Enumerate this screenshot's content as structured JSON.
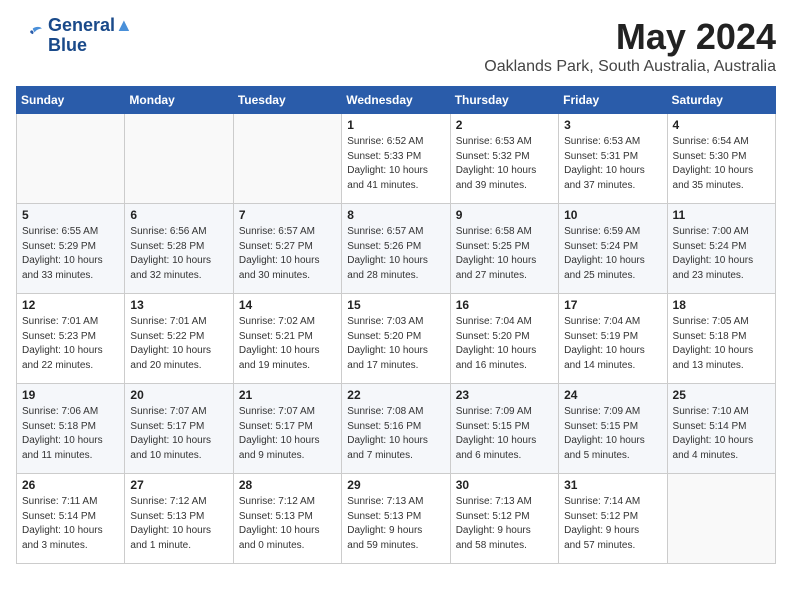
{
  "logo": {
    "line1": "General",
    "line2": "Blue"
  },
  "title": "May 2024",
  "location": "Oaklands Park, South Australia, Australia",
  "weekdays": [
    "Sunday",
    "Monday",
    "Tuesday",
    "Wednesday",
    "Thursday",
    "Friday",
    "Saturday"
  ],
  "weeks": [
    [
      {
        "day": "",
        "info": ""
      },
      {
        "day": "",
        "info": ""
      },
      {
        "day": "",
        "info": ""
      },
      {
        "day": "1",
        "info": "Sunrise: 6:52 AM\nSunset: 5:33 PM\nDaylight: 10 hours\nand 41 minutes."
      },
      {
        "day": "2",
        "info": "Sunrise: 6:53 AM\nSunset: 5:32 PM\nDaylight: 10 hours\nand 39 minutes."
      },
      {
        "day": "3",
        "info": "Sunrise: 6:53 AM\nSunset: 5:31 PM\nDaylight: 10 hours\nand 37 minutes."
      },
      {
        "day": "4",
        "info": "Sunrise: 6:54 AM\nSunset: 5:30 PM\nDaylight: 10 hours\nand 35 minutes."
      }
    ],
    [
      {
        "day": "5",
        "info": "Sunrise: 6:55 AM\nSunset: 5:29 PM\nDaylight: 10 hours\nand 33 minutes."
      },
      {
        "day": "6",
        "info": "Sunrise: 6:56 AM\nSunset: 5:28 PM\nDaylight: 10 hours\nand 32 minutes."
      },
      {
        "day": "7",
        "info": "Sunrise: 6:57 AM\nSunset: 5:27 PM\nDaylight: 10 hours\nand 30 minutes."
      },
      {
        "day": "8",
        "info": "Sunrise: 6:57 AM\nSunset: 5:26 PM\nDaylight: 10 hours\nand 28 minutes."
      },
      {
        "day": "9",
        "info": "Sunrise: 6:58 AM\nSunset: 5:25 PM\nDaylight: 10 hours\nand 27 minutes."
      },
      {
        "day": "10",
        "info": "Sunrise: 6:59 AM\nSunset: 5:24 PM\nDaylight: 10 hours\nand 25 minutes."
      },
      {
        "day": "11",
        "info": "Sunrise: 7:00 AM\nSunset: 5:24 PM\nDaylight: 10 hours\nand 23 minutes."
      }
    ],
    [
      {
        "day": "12",
        "info": "Sunrise: 7:01 AM\nSunset: 5:23 PM\nDaylight: 10 hours\nand 22 minutes."
      },
      {
        "day": "13",
        "info": "Sunrise: 7:01 AM\nSunset: 5:22 PM\nDaylight: 10 hours\nand 20 minutes."
      },
      {
        "day": "14",
        "info": "Sunrise: 7:02 AM\nSunset: 5:21 PM\nDaylight: 10 hours\nand 19 minutes."
      },
      {
        "day": "15",
        "info": "Sunrise: 7:03 AM\nSunset: 5:20 PM\nDaylight: 10 hours\nand 17 minutes."
      },
      {
        "day": "16",
        "info": "Sunrise: 7:04 AM\nSunset: 5:20 PM\nDaylight: 10 hours\nand 16 minutes."
      },
      {
        "day": "17",
        "info": "Sunrise: 7:04 AM\nSunset: 5:19 PM\nDaylight: 10 hours\nand 14 minutes."
      },
      {
        "day": "18",
        "info": "Sunrise: 7:05 AM\nSunset: 5:18 PM\nDaylight: 10 hours\nand 13 minutes."
      }
    ],
    [
      {
        "day": "19",
        "info": "Sunrise: 7:06 AM\nSunset: 5:18 PM\nDaylight: 10 hours\nand 11 minutes."
      },
      {
        "day": "20",
        "info": "Sunrise: 7:07 AM\nSunset: 5:17 PM\nDaylight: 10 hours\nand 10 minutes."
      },
      {
        "day": "21",
        "info": "Sunrise: 7:07 AM\nSunset: 5:17 PM\nDaylight: 10 hours\nand 9 minutes."
      },
      {
        "day": "22",
        "info": "Sunrise: 7:08 AM\nSunset: 5:16 PM\nDaylight: 10 hours\nand 7 minutes."
      },
      {
        "day": "23",
        "info": "Sunrise: 7:09 AM\nSunset: 5:15 PM\nDaylight: 10 hours\nand 6 minutes."
      },
      {
        "day": "24",
        "info": "Sunrise: 7:09 AM\nSunset: 5:15 PM\nDaylight: 10 hours\nand 5 minutes."
      },
      {
        "day": "25",
        "info": "Sunrise: 7:10 AM\nSunset: 5:14 PM\nDaylight: 10 hours\nand 4 minutes."
      }
    ],
    [
      {
        "day": "26",
        "info": "Sunrise: 7:11 AM\nSunset: 5:14 PM\nDaylight: 10 hours\nand 3 minutes."
      },
      {
        "day": "27",
        "info": "Sunrise: 7:12 AM\nSunset: 5:13 PM\nDaylight: 10 hours\nand 1 minute."
      },
      {
        "day": "28",
        "info": "Sunrise: 7:12 AM\nSunset: 5:13 PM\nDaylight: 10 hours\nand 0 minutes."
      },
      {
        "day": "29",
        "info": "Sunrise: 7:13 AM\nSunset: 5:13 PM\nDaylight: 9 hours\nand 59 minutes."
      },
      {
        "day": "30",
        "info": "Sunrise: 7:13 AM\nSunset: 5:12 PM\nDaylight: 9 hours\nand 58 minutes."
      },
      {
        "day": "31",
        "info": "Sunrise: 7:14 AM\nSunset: 5:12 PM\nDaylight: 9 hours\nand 57 minutes."
      },
      {
        "day": "",
        "info": ""
      }
    ]
  ]
}
